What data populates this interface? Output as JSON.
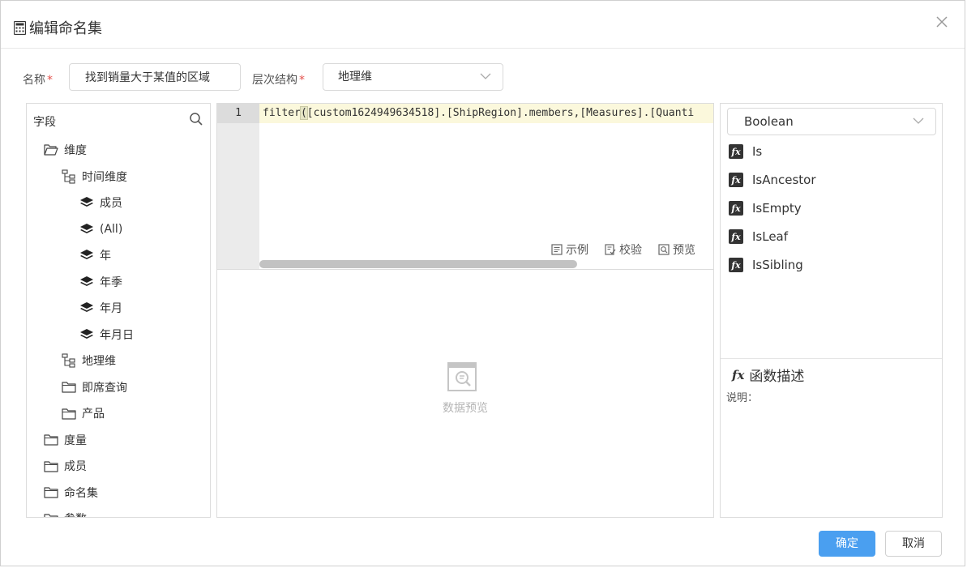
{
  "dialog": {
    "title": "编辑命名集"
  },
  "form": {
    "name_label": "名称",
    "name_value": "找到销量大于某值的区域",
    "hierarchy_label": "层次结构",
    "hierarchy_value": "地理维",
    "required_mark": "*"
  },
  "fields": {
    "header": "字段",
    "tree": [
      {
        "label": "维度",
        "icon": "folder-open-icon"
      },
      {
        "label": "时间维度",
        "icon": "hierarchy-icon"
      },
      {
        "label": "成员",
        "icon": "layers-icon"
      },
      {
        "label": "(All)",
        "icon": "layers-icon"
      },
      {
        "label": "年",
        "icon": "layers-icon"
      },
      {
        "label": "年季",
        "icon": "layers-icon"
      },
      {
        "label": "年月",
        "icon": "layers-icon"
      },
      {
        "label": "年月日",
        "icon": "layers-icon"
      },
      {
        "label": "地理维",
        "icon": "hierarchy-icon"
      },
      {
        "label": "即席查询",
        "icon": "folder-icon"
      },
      {
        "label": "产品",
        "icon": "folder-icon"
      },
      {
        "label": "度量",
        "icon": "folder-icon"
      },
      {
        "label": "成员",
        "icon": "folder-icon"
      },
      {
        "label": "命名集",
        "icon": "folder-icon"
      },
      {
        "label": "参数",
        "icon": "folder-icon"
      }
    ]
  },
  "editor": {
    "line_number": "1",
    "code_prefix": "filter",
    "code_paren": "(",
    "code_rest": "[custom1624949634518].[ShipRegion].members,[Measures].[Quanti",
    "tools": {
      "example": "示例",
      "validate": "校验",
      "preview": "预览"
    }
  },
  "preview": {
    "empty_text": "数据预览"
  },
  "functions": {
    "category": "Boolean",
    "items": [
      "Is",
      "IsAncestor",
      "IsEmpty",
      "IsLeaf",
      "IsSibling"
    ],
    "desc_title": "函数描述",
    "desc_label": "说明："
  },
  "buttons": {
    "ok": "确定",
    "cancel": "取消"
  },
  "colors": {
    "primary": "#4a9ff0",
    "required": "#e4504b",
    "code_highlight": "#fbf8dc"
  }
}
